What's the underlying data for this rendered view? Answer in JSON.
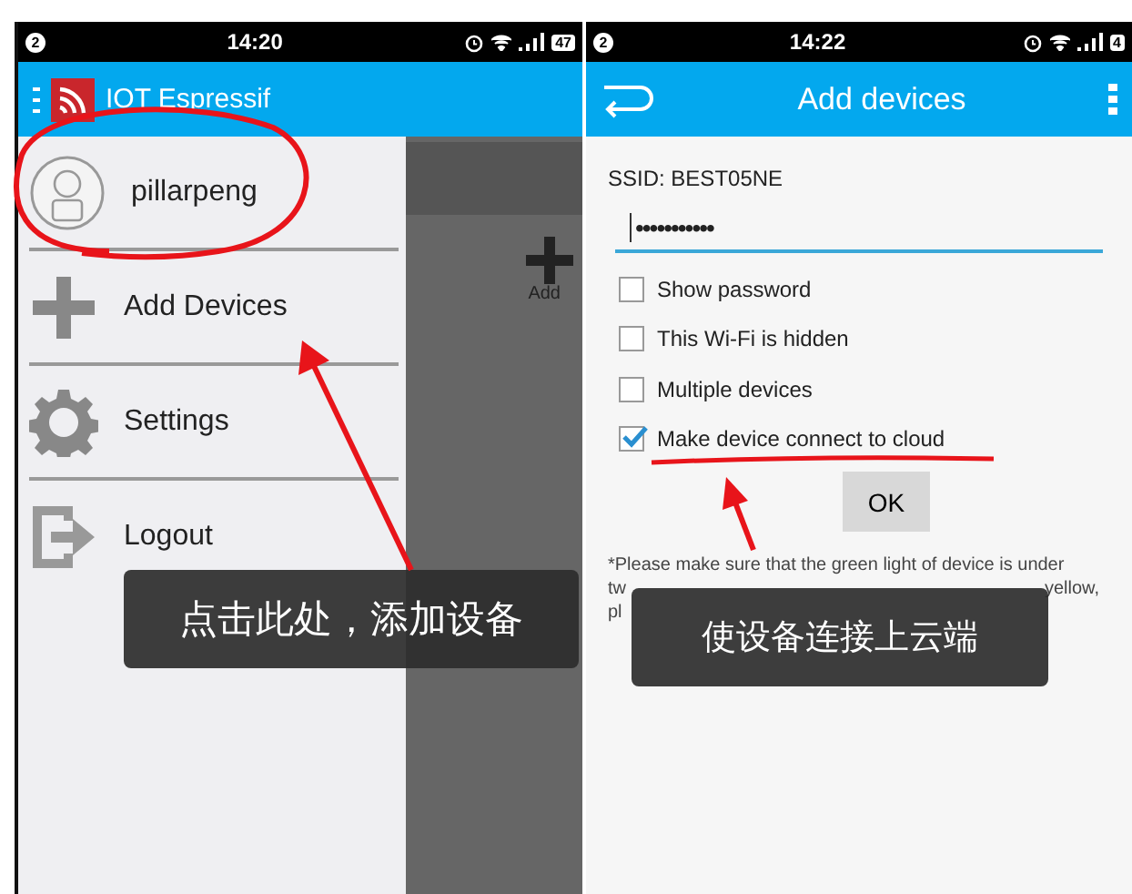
{
  "left_screen": {
    "status_bar": {
      "notification": "2",
      "time": "14:20",
      "battery": "47"
    },
    "app_bar": {
      "title": "IOT Espressif"
    },
    "drawer": {
      "user": "pillarpeng",
      "items": [
        {
          "kind": "plus",
          "label": "Add Devices"
        },
        {
          "kind": "gear",
          "label": "Settings"
        },
        {
          "kind": "logout",
          "label": "Logout"
        }
      ]
    },
    "behind": {
      "action_label": "Add"
    },
    "toast": "点击此处，添加设备"
  },
  "right_screen": {
    "status_bar": {
      "notification": "2",
      "time": "14:22",
      "battery": "4"
    },
    "app_bar": {
      "title": "Add devices"
    },
    "ssid_label": "SSID: BEST05NE",
    "password": "•••••••••••",
    "options": [
      {
        "label": "Show password",
        "checked": false
      },
      {
        "label": "This Wi-Fi is hidden",
        "checked": false
      },
      {
        "label": "Multiple devices",
        "checked": false
      },
      {
        "label": "Make device connect to cloud",
        "checked": true
      }
    ],
    "ok_button": "OK",
    "footnote_lines": [
      [
        "*Please make sure that the green light of device is under"
      ],
      [
        "tw",
        "yellow,"
      ],
      [
        "pl"
      ]
    ],
    "toast": "使设备连接上云端"
  }
}
